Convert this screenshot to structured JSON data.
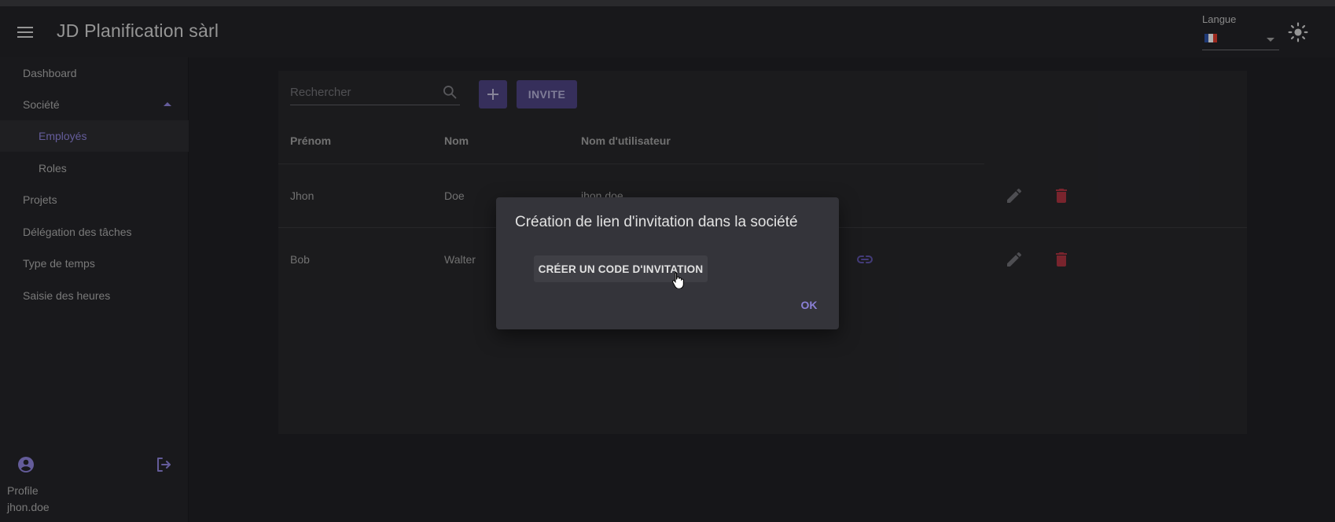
{
  "app": {
    "title": "JD Planification sàrl"
  },
  "header": {
    "language_label": "Langue",
    "language_flag": [
      "#2b4fa3",
      "#f4f4f4",
      "#d8392b"
    ],
    "menu_icon": "menu-icon",
    "theme_icon": "sun-icon"
  },
  "sidebar": {
    "items": [
      {
        "label": "Dashboard"
      },
      {
        "label": "Société"
      },
      {
        "label": "Employés"
      },
      {
        "label": "Roles"
      },
      {
        "label": "Projets"
      },
      {
        "label": "Délégation des tâches"
      },
      {
        "label": "Type de temps"
      },
      {
        "label": "Saisie des heures"
      }
    ],
    "profile_label": "Profile",
    "username": "jhon.doe"
  },
  "toolbar": {
    "search_placeholder": "Rechercher",
    "invite_label": "INVITE"
  },
  "table": {
    "headers": [
      "Prénom",
      "Nom",
      "Nom d'utilisateur"
    ],
    "rows": [
      {
        "first": "Jhon",
        "last": "Doe",
        "username": "jhon.doe"
      },
      {
        "first": "Bob",
        "last": "Walter",
        "username": ""
      }
    ]
  },
  "dialog": {
    "title": "Création de lien d'invitation dans la société",
    "create_code_label": "CRÉER UN CODE D'INVITATION",
    "ok_label": "OK"
  },
  "colors": {
    "accent": "#8b80d6",
    "button": "#52488f",
    "delete": "#a8333f"
  }
}
